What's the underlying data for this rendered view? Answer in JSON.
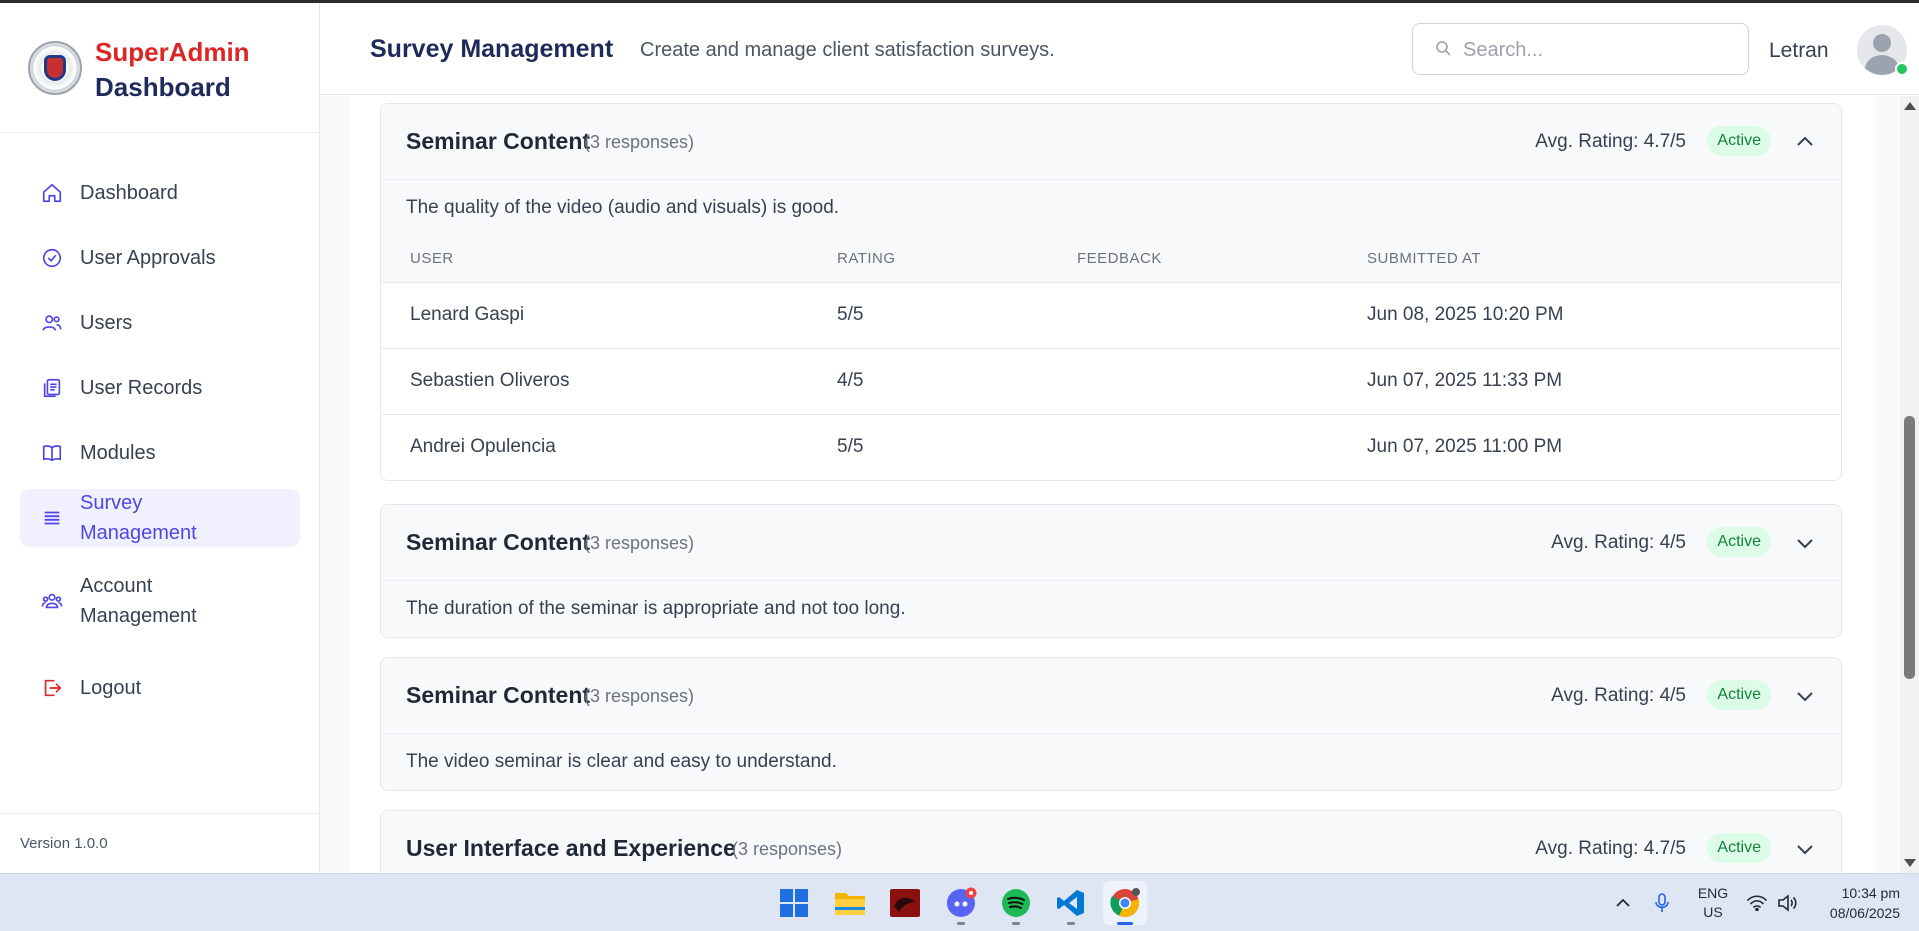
{
  "brand": {
    "line1": "SuperAdmin",
    "line2": "Dashboard"
  },
  "sidebar": {
    "items": [
      {
        "label": "Dashboard",
        "icon": "home-icon"
      },
      {
        "label": "User Approvals",
        "icon": "check-circle-icon"
      },
      {
        "label": "Users",
        "icon": "users-icon"
      },
      {
        "label": "User Records",
        "icon": "records-icon"
      },
      {
        "label": "Modules",
        "icon": "book-icon"
      },
      {
        "label": "Survey Management",
        "icon": "list-icon",
        "active": true
      },
      {
        "label": "Account Management",
        "icon": "account-group-icon"
      },
      {
        "label": "Logout",
        "icon": "logout-icon"
      }
    ],
    "version": "Version 1.0.0"
  },
  "header": {
    "title": "Survey Management",
    "subtitle": "Create and manage client satisfaction surveys.",
    "search_placeholder": "Search...",
    "user_name": "Letran"
  },
  "table_headers": [
    "USER",
    "RATING",
    "FEEDBACK",
    "SUBMITTED AT"
  ],
  "surveys": [
    {
      "category": "Seminar Content",
      "responses": "(3 responses)",
      "avg_rating": "Avg. Rating: 4.7/5",
      "status": "Active",
      "expanded": true,
      "question": "The quality of the video (audio and visuals) is good.",
      "rows": [
        {
          "user": "Lenard Gaspi",
          "rating": "5/5",
          "feedback": "",
          "submitted": "Jun 08, 2025 10:20 PM"
        },
        {
          "user": "Sebastien Oliveros",
          "rating": "4/5",
          "feedback": "",
          "submitted": "Jun 07, 2025 11:33 PM"
        },
        {
          "user": "Andrei Opulencia",
          "rating": "5/5",
          "feedback": "",
          "submitted": "Jun 07, 2025 11:00 PM"
        }
      ]
    },
    {
      "category": "Seminar Content",
      "responses": "(3 responses)",
      "avg_rating": "Avg. Rating: 4/5",
      "status": "Active",
      "expanded": false,
      "question": "The duration of the seminar is appropriate and not too long."
    },
    {
      "category": "Seminar Content",
      "responses": "(3 responses)",
      "avg_rating": "Avg. Rating: 4/5",
      "status": "Active",
      "expanded": false,
      "question": "The video seminar is clear and easy to understand."
    },
    {
      "category": "User Interface and Experience",
      "responses": "(3 responses)",
      "avg_rating": "Avg. Rating: 4.7/5",
      "status": "Active",
      "expanded": false
    }
  ],
  "taskbar": {
    "apps": [
      "windows-start-icon",
      "file-explorer-icon",
      "red-app-icon",
      "discord-icon",
      "spotify-icon",
      "vscode-icon",
      "chrome-icon"
    ],
    "lang_line1": "ENG",
    "lang_line2": "US",
    "time": "10:34 pm",
    "date": "08/06/2025"
  },
  "colors": {
    "brand_red": "#dc2626",
    "brand_navy": "#1e2a5a",
    "active_nav": "#4f46e5",
    "badge_bg": "#dcfce7",
    "badge_text": "#15803d"
  }
}
